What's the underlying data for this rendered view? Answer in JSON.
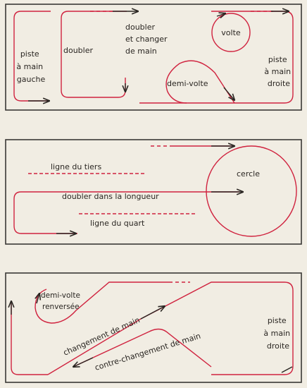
{
  "colors": {
    "paper": "#f1ede3",
    "arena_border": "#3a3835",
    "track": "#d0233f",
    "arrow": "#2a2622",
    "text": "#2a2622"
  },
  "panel1": {
    "left_track": [
      "piste",
      "à main",
      "gauche"
    ],
    "doubler": "doubler",
    "doubler_changer": [
      "doubler",
      "et changer",
      "de main"
    ],
    "volte": "volte",
    "demi_volte": "demi-volte",
    "right_track": [
      "piste",
      "à main",
      "droite"
    ]
  },
  "panel2": {
    "ligne_tiers": "ligne du tiers",
    "doubler_longueur": "doubler dans la longueur",
    "ligne_quart": "ligne du quart",
    "cercle": "cercle"
  },
  "panel3": {
    "demi_volte_renversee": [
      "demi-volte",
      "renversée"
    ],
    "changement": "changement de main",
    "contre_changement": "contre-changement de main",
    "right_track": [
      "piste",
      "à main",
      "droite"
    ]
  }
}
